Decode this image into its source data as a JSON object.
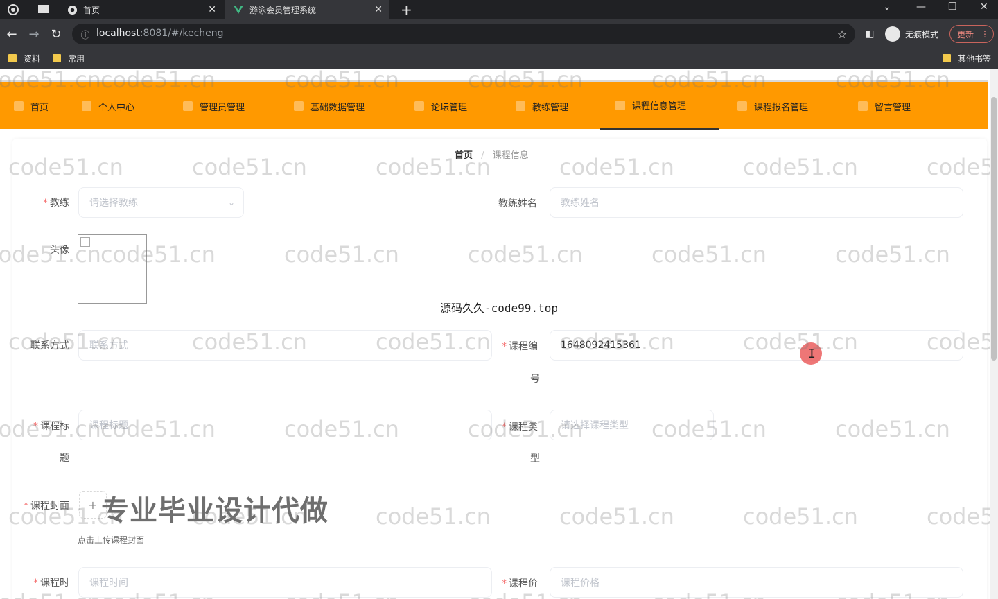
{
  "browser": {
    "tabs": [
      {
        "label": "首页",
        "active": false
      },
      {
        "label": "游泳会员管理系统",
        "active": true
      }
    ],
    "new_tab": "+",
    "url_host": "localhost",
    "url_rest": ":8081/#/kecheng",
    "incognito_label": "无痕模式",
    "update_label": "更新",
    "bookmarks": [
      "资料",
      "常用"
    ],
    "other_bookmarks": "其他书签"
  },
  "menu": {
    "items": [
      "首页",
      "个人中心",
      "管理员管理",
      "基础数据管理",
      "论坛管理",
      "教练管理",
      "课程信息管理",
      "课程报名管理",
      "留言管理"
    ],
    "active": "课程信息管理"
  },
  "breadcrumb": {
    "home": "首页",
    "sep": "/",
    "current": "课程信息"
  },
  "form": {
    "coach_label": "教练",
    "coach_placeholder": "请选择教练",
    "coach_name_label": "教练姓名",
    "coach_name_placeholder": "教练姓名",
    "avatar_label": "头像",
    "contact_label": "联系方式",
    "contact_placeholder": "联系方式",
    "course_no_label_1": "课程编",
    "course_no_label_2": "号",
    "course_no_value": "1648092415361",
    "title_label_1": "课程标",
    "title_label_2": "题",
    "title_placeholder": "课程标题",
    "type_label_1": "课程类",
    "type_label_2": "型",
    "type_placeholder": "请选择课程类型",
    "cover_label": "课程封面",
    "cover_hint": "点击上传课程封面",
    "time_label": "课程时",
    "time_placeholder": "课程时间",
    "price_label": "课程价",
    "price_placeholder": "课程价格"
  },
  "overlays": {
    "center_text": "源码久久-code99.top",
    "banner": "专业毕业设计代做",
    "watermark": "code51.cn"
  },
  "colors": {
    "menu_bg": "#ff9900",
    "required": "#f56c6c"
  }
}
